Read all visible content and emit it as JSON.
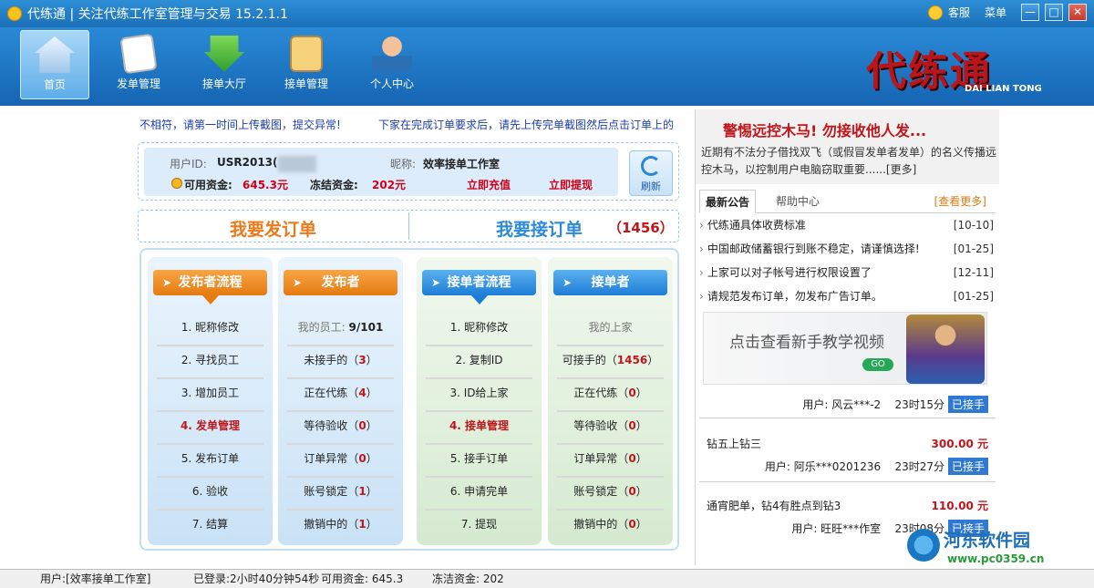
{
  "window": {
    "title": "代练通 | 关注代练工作室管理与交易 15.2.1.1",
    "service_label": "客服",
    "menu_label": "菜单",
    "minimize": "—",
    "maximize": "□",
    "close": "✕"
  },
  "toolbar": {
    "items": [
      {
        "label": "首页",
        "icon": "home-icon"
      },
      {
        "label": "发单管理",
        "icon": "document-icon"
      },
      {
        "label": "接单大厅",
        "icon": "download-icon"
      },
      {
        "label": "接单管理",
        "icon": "clipboard-icon"
      },
      {
        "label": "个人中心",
        "icon": "user-icon"
      }
    ],
    "logo_text": "代练通",
    "logo_sub": "DAI LIAN TONG"
  },
  "notices": {
    "left": "不相符，请第一时间上传截图，提交异常!",
    "right": "下家在完成订单要求后，请先上传完单截图然后点击订单上的"
  },
  "user": {
    "id_label": "用户ID:",
    "id_value": "USR2013(",
    "nick_label": "昵称:",
    "nick_value": "效率接单工作室",
    "available_label": "可用资金:",
    "available_value": "645.3元",
    "frozen_label": "冻结资金:",
    "frozen_value": "202元",
    "recharge": "立即充值",
    "withdraw": "立即提现",
    "refresh": "刷新"
  },
  "big": {
    "publish": "我要发订单",
    "accept": "我要接订单",
    "accept_count": "（1456）"
  },
  "publisher_flow": {
    "head": "发布者流程",
    "items": [
      "1.  昵称修改",
      "2.  寻找员工",
      "3.  增加员工",
      "4.  发单管理",
      "5.  发布订单",
      "6.  验收",
      "7.  结算"
    ]
  },
  "publisher": {
    "head": "发布者",
    "staff_label": "我的员工:",
    "staff_value": "9/101",
    "items": [
      {
        "label": "未接手的（",
        "num": "3",
        "end": "）"
      },
      {
        "label": "正在代练（",
        "num": "4",
        "end": "）"
      },
      {
        "label": "等待验收（",
        "num": "0",
        "end": "）"
      },
      {
        "label": "订单异常（",
        "num": "0",
        "end": "）"
      },
      {
        "label": "账号锁定（",
        "num": "1",
        "end": "）"
      },
      {
        "label": "撤销中的（",
        "num": "1",
        "end": "）"
      }
    ]
  },
  "accepter_flow": {
    "head": "接单者流程",
    "items": [
      "1.  昵称修改",
      "2.  复制ID",
      "3.  ID给上家",
      "4.  接单管理",
      "5.  接手订单",
      "6.  申请完单",
      "7.  提现"
    ]
  },
  "accepter": {
    "head": "接单者",
    "upstream_label": "我的上家",
    "items": [
      {
        "label": "可接手的（",
        "num": "1456",
        "end": "）"
      },
      {
        "label": "正在代练（",
        "num": "0",
        "end": "）"
      },
      {
        "label": "等待验收（",
        "num": "0",
        "end": "）"
      },
      {
        "label": "订单异常（",
        "num": "0",
        "end": "）"
      },
      {
        "label": "账号锁定（",
        "num": "0",
        "end": "）"
      },
      {
        "label": "撤销中的（",
        "num": "0",
        "end": "）"
      }
    ]
  },
  "right": {
    "warn_title": "警惕远控木马! 勿接收他人发...",
    "warn_text": "近期有不法分子借找双飞（或假冒发单者发单）的名义传播远控木马，以控制用户电脑窃取重要......[更多]",
    "tab_announce": "最新公告",
    "tab_help": "帮助中心",
    "tab_more": "[查看更多]",
    "news": [
      {
        "title": "代练通具体收费标准",
        "date": "[10-10]"
      },
      {
        "title": "中国邮政储蓄银行到账不稳定，请谨慎选择!",
        "date": "[01-25]"
      },
      {
        "title": "上家可以对子帐号进行权限设置了",
        "date": "[12-11]"
      },
      {
        "title": "请规范发布订单，勿发布广告订单。",
        "date": "[01-25]"
      }
    ],
    "banner_text": "点击查看新手教学视频",
    "banner_go": "GO",
    "orders": [
      {
        "title": "",
        "price": "",
        "user": "用户: 风云***-2",
        "time": "23时15分",
        "status": "已接手"
      },
      {
        "title": "钻五上钻三",
        "price": "300.00 元",
        "user": "用户: 阿乐***0201236",
        "time": "23时27分",
        "status": "已接手"
      },
      {
        "title": "通宵肥单，钻4有胜点到钻3",
        "price": "110.00 元",
        "user": "用户: 旺旺***作室",
        "time": "23时08分",
        "status": "已接手"
      }
    ]
  },
  "status": {
    "user": "用户:[效率接单工作室]",
    "logged": "已登录:2小时40分钟54秒",
    "available": "可用资金: 645.3",
    "frozen": "冻洁资金: 202"
  },
  "watermark": {
    "name": "河东软件园",
    "url": "www.pc0359.cn"
  }
}
